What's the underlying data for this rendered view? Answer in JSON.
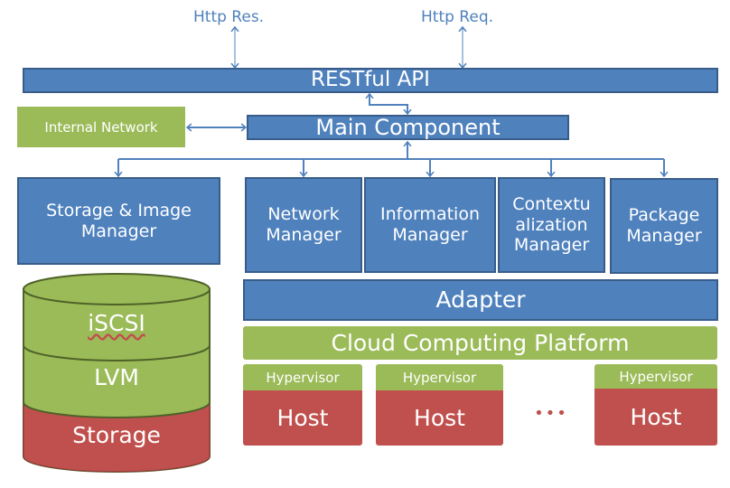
{
  "labels": {
    "http_res": "Http  Res.",
    "http_req": "Http  Req."
  },
  "restful_api": "RESTful API",
  "internal_network": "Internal  Network",
  "main_component": "Main Component",
  "managers": {
    "storage_image": "Storage  & Image Manager",
    "network": "Network Manager",
    "information": "Information Manager",
    "contextualization": "Contextu alization Manager",
    "package": "Package Manager"
  },
  "adapter": "Adapter",
  "cloud_platform": "Cloud Computing Platform",
  "hosts": [
    {
      "hypervisor": "Hypervisor",
      "host": "Host"
    },
    {
      "hypervisor": "Hypervisor",
      "host": "Host"
    },
    {
      "hypervisor": "Hypervisor",
      "host": "Host"
    }
  ],
  "ellipsis": "•••",
  "storage_stack": {
    "top": "iSCSI",
    "middle": "LVM",
    "bottom": "Storage"
  },
  "colors": {
    "blue": "#4f81bd",
    "blue_border": "#385d8a",
    "green": "#9bbb59",
    "red": "#c0504d"
  }
}
